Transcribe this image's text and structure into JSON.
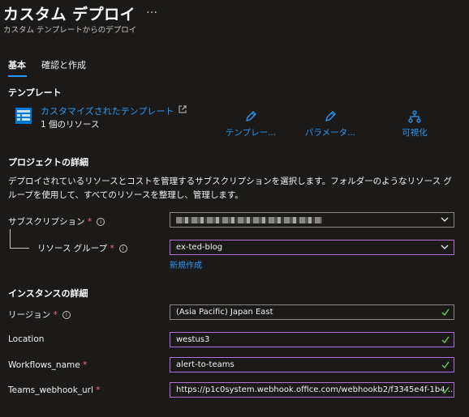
{
  "header": {
    "title": "カスタム デプロイ",
    "more": "…",
    "subtitle": "カスタム テンプレートからのデプロイ"
  },
  "tabs": [
    {
      "label": "基本",
      "active": true
    },
    {
      "label": "確認と作成",
      "active": false
    }
  ],
  "template_section": {
    "heading": "テンプレート",
    "link": "カスタマイズされたテンプレート",
    "count": "1 個のリソース",
    "actions": [
      {
        "label": "テンプレー...",
        "icon": "pencil-icon"
      },
      {
        "label": "パラメータ...",
        "icon": "pencil-icon"
      },
      {
        "label": "可視化",
        "icon": "hierarchy-icon"
      }
    ]
  },
  "project_section": {
    "heading": "プロジェクトの詳細",
    "description": "デプロイされているリソースとコストを管理するサブスクリプションを選択します。フォルダーのようなリソース グループを使用して、すべてのリソースを整理し、管理します。",
    "subscription_label": "サブスクリプション",
    "resource_group_label": "リソース グループ",
    "resource_group_value": "ex-ted-blog",
    "create_new": "新規作成"
  },
  "instance_section": {
    "heading": "インスタンスの詳細",
    "region_label": "リージョン",
    "region_value": "(Asia Pacific) Japan East",
    "location_label": "Location",
    "location_value": "westus3",
    "workflows_label": "Workflows_name",
    "workflows_value": "alert-to-teams",
    "webhook_label": "Teams_webhook_url",
    "webhook_value": "https://p1c0system.webhook.office.com/webhookb2/f3345e4f-1b4 ..."
  },
  "colors": {
    "accent": "#2899f5",
    "required": "#f1707b",
    "valid": "#6ccb5f",
    "focus_border": "#b16fd8"
  }
}
